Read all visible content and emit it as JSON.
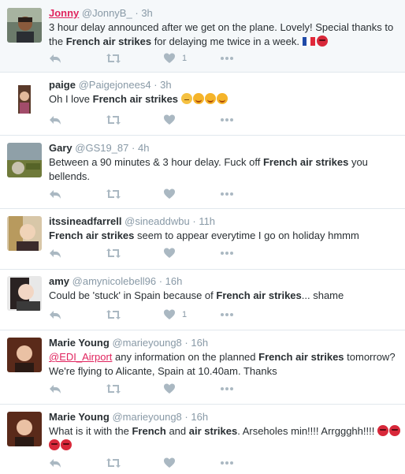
{
  "colors": {
    "name_highlight": "#e0245e",
    "handle": "#8899a6",
    "icon": "#aab8c2",
    "angry": "#d8283a",
    "smile": "#f5b42a"
  },
  "tweets": [
    {
      "name": "Jonny",
      "handle": "@JonnyB_",
      "time": "3h",
      "text_before": "3 hour delay announced after we get on the plane. Lovely! Special thanks to the ",
      "bold": "French air strikes",
      "text_after": " for delaying me twice in a week. ",
      "likes": "1",
      "emoji": [
        "flag-fr-icon",
        "angry-face-icon"
      ]
    },
    {
      "name": "paige",
      "handle": "@Paigejonees4",
      "time": "3h",
      "text_before": "Oh I love ",
      "bold": "French air strikes",
      "text_after": " ",
      "likes": "",
      "emoji": [
        "eye-roll-face-icon",
        "smiling-face-icon",
        "smiling-face-icon",
        "smiling-face-icon"
      ]
    },
    {
      "name": "Gary",
      "handle": "@GS19_87",
      "time": "4h",
      "text_before": "Between a 90 minutes & 3 hour delay. Fuck off ",
      "bold": "French air strikes",
      "text_after": " you bellends.",
      "likes": ""
    },
    {
      "name": "itssineadfarrell",
      "handle": "@sineaddwbu",
      "time": "11h",
      "text_before": "",
      "bold": "French air strikes",
      "text_after": " seem to appear everytime I go on holiday hmmm",
      "likes": ""
    },
    {
      "name": "amy",
      "handle": "@amynicolebell96",
      "time": "16h",
      "text_before": "Could be 'stuck' in Spain because of ",
      "bold": "French air strikes",
      "text_after": "... shame",
      "likes": "1"
    },
    {
      "name": "Marie Young",
      "handle": "@marieyoung8",
      "time": "16h",
      "mention": "@EDI_Airport",
      "text_before": " any information on the planned ",
      "bold": "French air strikes",
      "text_after": " tomorrow? We're flying to Alicante, Spain at 10.40am. Thanks",
      "likes": ""
    },
    {
      "name": "Marie Young",
      "handle": "@marieyoung8",
      "time": "16h",
      "text_before": "What is it with the ",
      "bold": "French",
      "text_mid": " and ",
      "bold2": "air strikes",
      "text_after": ". Arseholes min!!!! Arrggghh!!!! ",
      "likes": "",
      "emoji": [
        "angry-face-icon",
        "angry-face-icon",
        "angry-face-icon",
        "angry-face-icon"
      ]
    }
  ]
}
